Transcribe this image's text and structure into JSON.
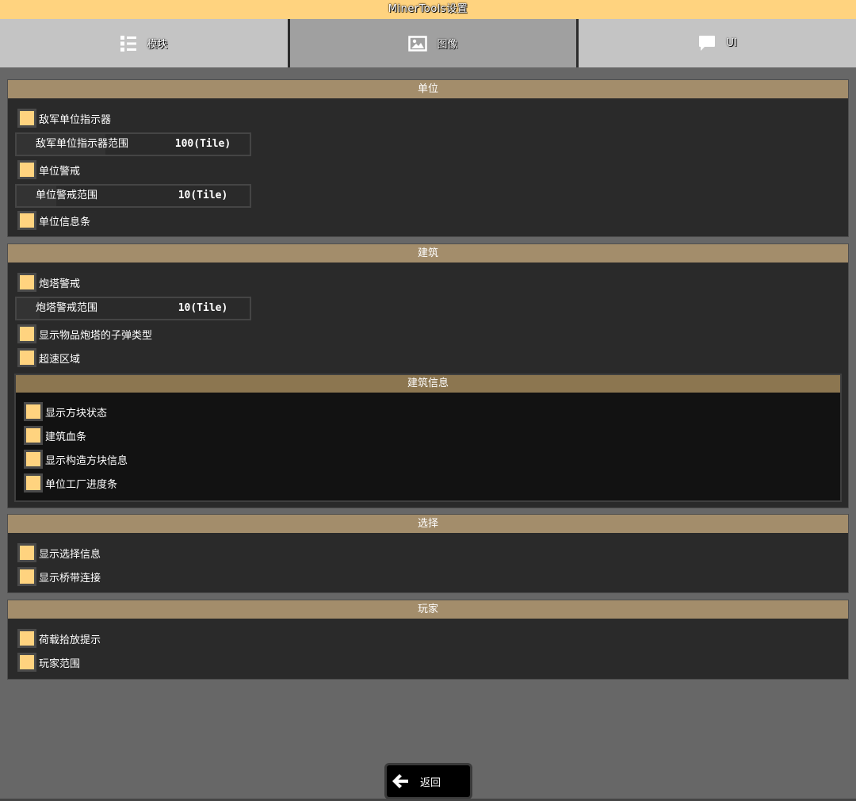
{
  "window": {
    "title": "MinerTools设置"
  },
  "tabs": [
    {
      "label": "模块",
      "icon": "list-icon"
    },
    {
      "label": "图像",
      "icon": "image-icon"
    },
    {
      "label": "UI",
      "icon": "chat-icon"
    }
  ],
  "sections": {
    "units": {
      "header": "单位",
      "enemy_indicator": "敌军单位指示器",
      "enemy_range_label": "敌军单位指示器范围",
      "enemy_range_value": "100(Tile)",
      "enemy_range_fraction": 0.38,
      "unit_alert": "单位警戒",
      "unit_alert_range_label": "单位警戒范围",
      "unit_alert_range_value": "10(Tile)",
      "unit_alert_range_fraction": 0.17,
      "unit_info_bar": "单位信息条"
    },
    "buildings": {
      "header": "建筑",
      "turret_alert": "炮塔警戒",
      "turret_range_label": "炮塔警戒范围",
      "turret_range_value": "10(Tile)",
      "turret_range_fraction": 0.1,
      "item_turret_ammo": "显示物品炮塔的子弹类型",
      "overdrive_zone": "超速区域",
      "info": {
        "header": "建筑信息",
        "block_status": "显示方块状态",
        "health_bar": "建筑血条",
        "construct_info": "显示构造方块信息",
        "factory_progress": "单位工厂进度条"
      }
    },
    "select": {
      "header": "选择",
      "select_info": "显示选择信息",
      "bridge_links": "显示桥带连接"
    },
    "player": {
      "header": "玩家",
      "payload_hint": "荷载拾放提示",
      "player_range": "玩家范围"
    }
  },
  "footer": {
    "back_label": "返回",
    "back_icon": "arrow-left-icon"
  },
  "colors": {
    "accent": "#ffd37f",
    "section_header": "#a38d6b",
    "subsection_header": "#8c7650"
  }
}
